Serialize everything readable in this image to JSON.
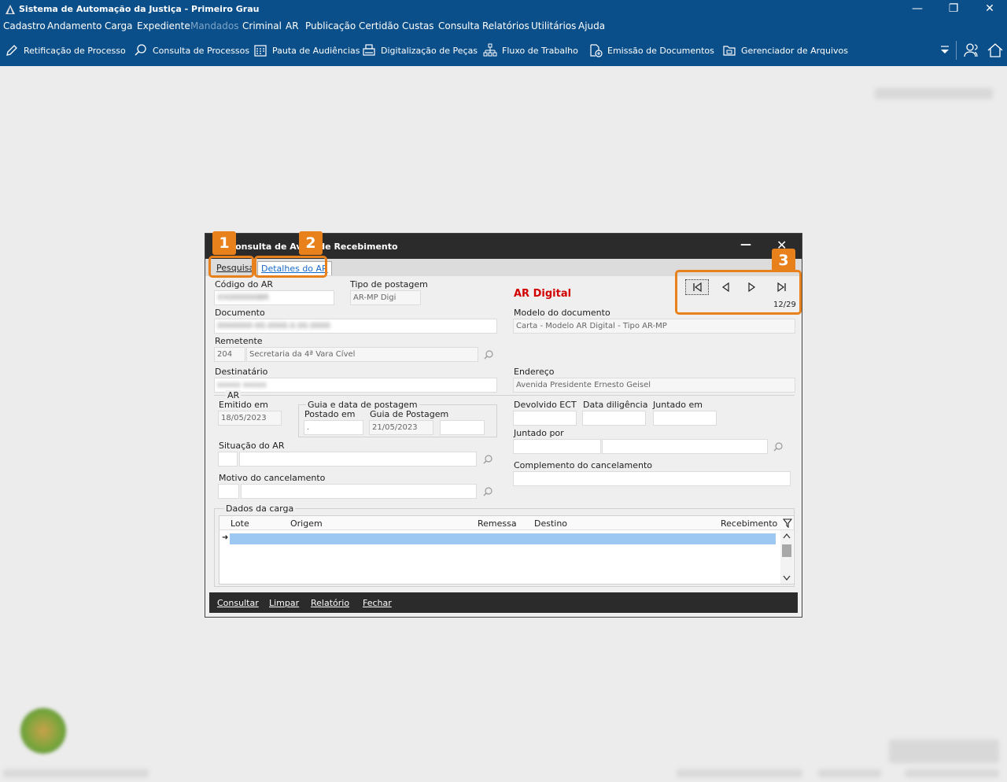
{
  "window": {
    "title": "Sistema de Automação da Justiça - Primeiro Grau"
  },
  "menu": [
    "Cadastro",
    "Andamento",
    "Carga",
    "Expediente",
    "Mandados",
    "Criminal",
    "AR",
    "Publicação",
    "Certidão",
    "Custas",
    "Consulta",
    "Relatórios",
    "Utilitários",
    "Ajuda"
  ],
  "toolbar": {
    "retificacao": "Retificação de Processo",
    "consulta": "Consulta de Processos",
    "pauta": "Pauta de Audiências",
    "digitalizacao": "Digitalização de Peças",
    "fluxo": "Fluxo de Trabalho",
    "emissao": "Emissão de Documentos",
    "gerenciador": "Gerenciador de Arquivos"
  },
  "dialog": {
    "title": "Consulta de Aviso de Recebimento",
    "tabs": {
      "pesquisa": "Pesquisa",
      "detalhes": "Detalhes do AR"
    },
    "ar_title": "AR Digital",
    "labels": {
      "codigo": "Código do AR",
      "tipo_postagem": "Tipo de postagem",
      "documento": "Documento",
      "modelo": "Modelo do documento",
      "remetente": "Remetente",
      "destinatario": "Destinatário",
      "endereco": "Endereço",
      "ar_group": "AR",
      "emitido": "Emitido em",
      "guia_group": "Guia e data de postagem",
      "postado": "Postado em",
      "guia_postagem": "Guia de Postagem",
      "devolvido": "Devolvido ECT",
      "data_diligencia": "Data diligência",
      "juntado_em": "Juntado em",
      "juntado_por": "Juntado por",
      "situacao": "Situação do AR",
      "motivo": "Motivo do cancelamento",
      "complemento": "Complemento do cancelamento",
      "dados_carga": "Dados da carga"
    },
    "values": {
      "codigo": "XX000000BR",
      "tipo_postagem": "AR-MP Digi",
      "documento": "0000000-00.0000.0.00.0000",
      "modelo": "Carta - Modelo AR Digital - Tipo AR-MP",
      "remetente_cod": "204",
      "remetente_nome": "Secretaria  da 4ª Vara Cível",
      "destinatario": "xxxxx xxxxx",
      "endereco": "Avenida Presidente Ernesto Geisel",
      "emitido": "18/05/2023",
      "postado": ".",
      "guia_postagem": "21/05/2023"
    },
    "nav": {
      "counter": "12/29"
    },
    "grid": {
      "columns": [
        "Lote",
        "Origem",
        "Remessa",
        "Destino",
        "Recebimento"
      ]
    },
    "buttons": {
      "consultar": "Consultar",
      "limpar": "Limpar",
      "relatorio": "Relatório",
      "fechar": "Fechar"
    },
    "badges": [
      "1",
      "2",
      "3"
    ]
  },
  "colors": {
    "header": "#0b4f8a",
    "dialog_title": "#2b2b2b",
    "accent": "#e8801c",
    "ar_title": "#d20000",
    "selected_row": "#9cc8f2"
  }
}
